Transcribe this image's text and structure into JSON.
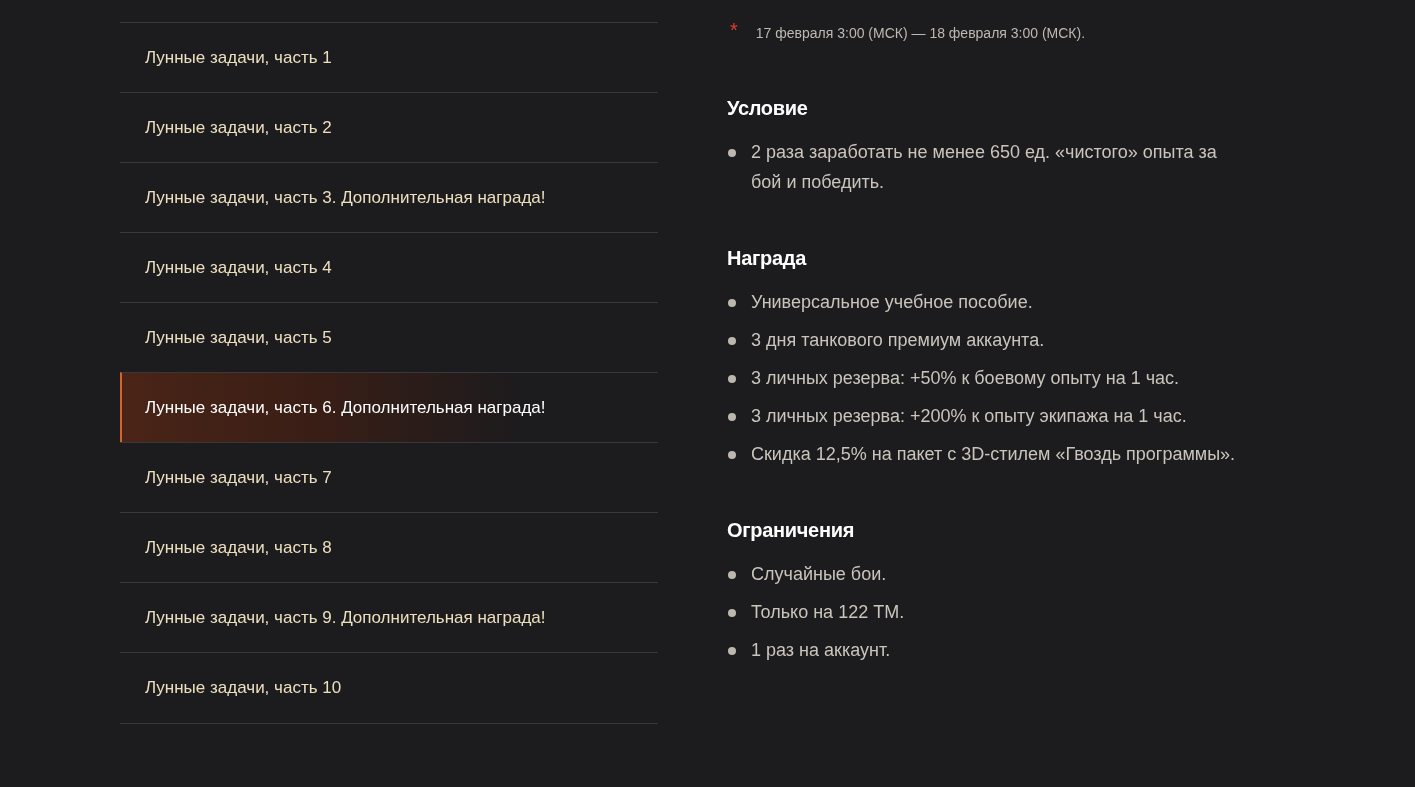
{
  "quest_menu": [
    {
      "label": "Лунные задачи, часть 1",
      "selected": false
    },
    {
      "label": "Лунные задачи, часть 2",
      "selected": false
    },
    {
      "label": "Лунные задачи, часть 3. Дополнительная награда!",
      "selected": false
    },
    {
      "label": "Лунные задачи, часть 4",
      "selected": false
    },
    {
      "label": "Лунные задачи, часть 5",
      "selected": false
    },
    {
      "label": "Лунные задачи, часть 6. Дополнительная награда!",
      "selected": true
    },
    {
      "label": "Лунные задачи, часть 7",
      "selected": false
    },
    {
      "label": "Лунные задачи, часть 8",
      "selected": false
    },
    {
      "label": "Лунные задачи, часть 9. Дополнительная награда!",
      "selected": false
    },
    {
      "label": "Лунные задачи, часть 10",
      "selected": false
    }
  ],
  "details": {
    "date_note": {
      "marker": "*",
      "text": "17 февраля 3:00 (МСК) — 18 февраля 3:00 (МСК)."
    },
    "sections": [
      {
        "heading": "Условие",
        "items": [
          "2 раза заработать не менее 650 ед. «чистого» опыта за бой и победить."
        ]
      },
      {
        "heading": "Награда",
        "items": [
          "Универсальное учебное пособие.",
          "3 дня танкового премиум аккаунта.",
          "3 личных резерва: +50% к боевому опыту на 1 час.",
          "3 личных резерва: +200% к опыту экипажа на 1 час.",
          "Скидка 12,5% на пакет с 3D-стилем «Гвоздь программы»."
        ]
      },
      {
        "heading": "Ограничения",
        "items": [
          "Случайные бои.",
          "Только на 122 ТМ.",
          "1 раз на аккаунт."
        ]
      }
    ]
  }
}
